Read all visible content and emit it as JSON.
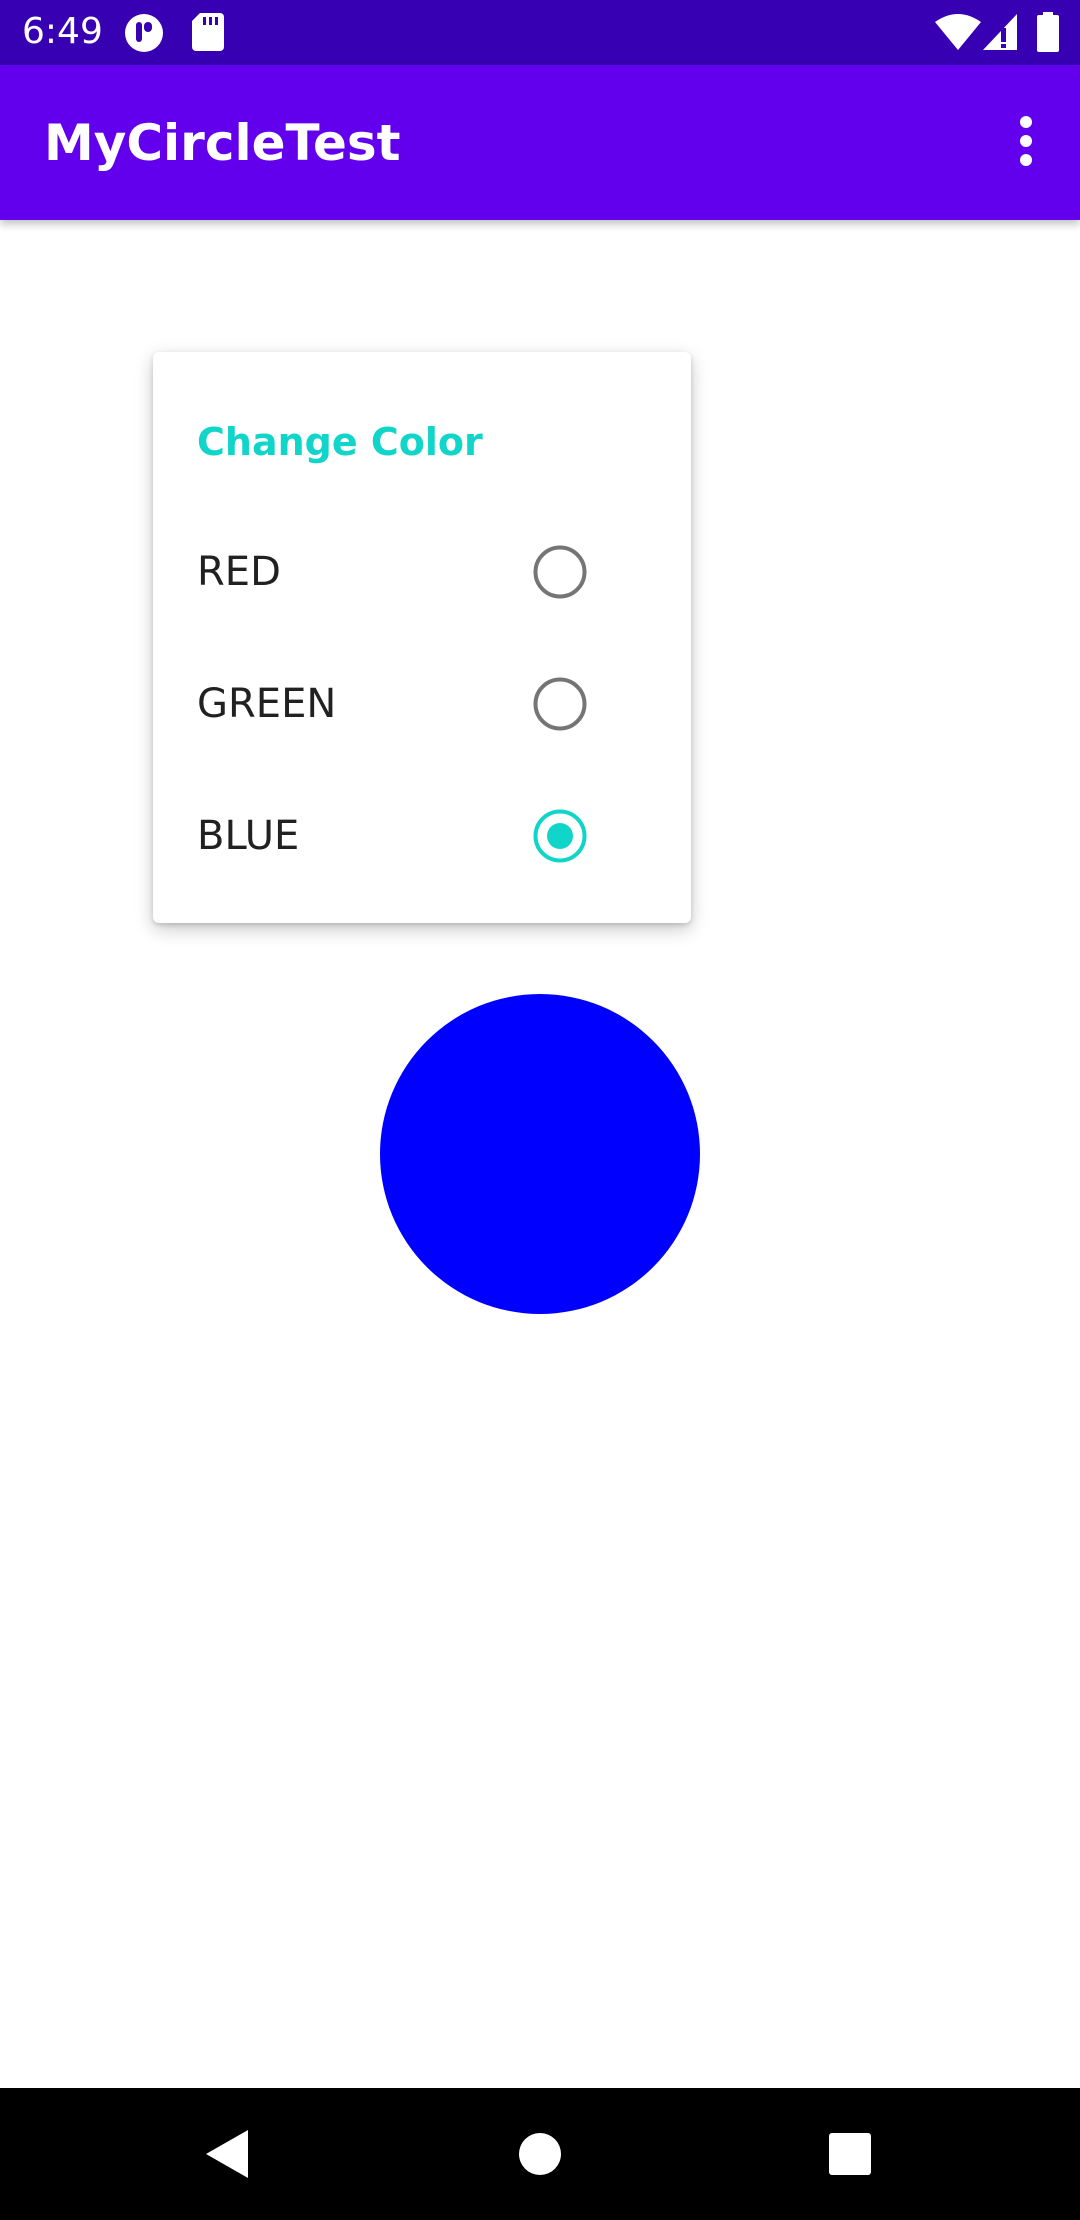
{
  "status_bar": {
    "time": "6:49",
    "background": "#3700B3",
    "icons": [
      "pill-icon",
      "sd-card-icon",
      "wifi-icon",
      "cell-signal-icon",
      "battery-icon"
    ]
  },
  "app_bar": {
    "title": "MyCircleTest",
    "background": "#6200EE",
    "overflow_icon": "more-vert-icon"
  },
  "menu": {
    "header": "Change Color",
    "accent": "#10D5C8",
    "items": [
      {
        "label": "RED",
        "selected": false
      },
      {
        "label": "GREEN",
        "selected": false
      },
      {
        "label": "BLUE",
        "selected": true
      }
    ]
  },
  "circle": {
    "color": "#0000FF"
  },
  "nav_bar": {
    "buttons": [
      "back-icon",
      "home-icon",
      "recents-icon"
    ]
  }
}
